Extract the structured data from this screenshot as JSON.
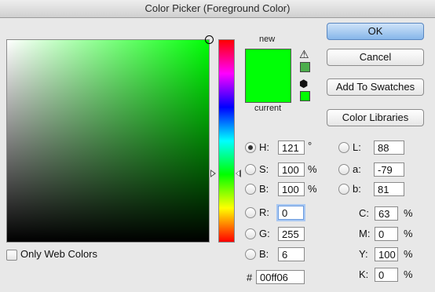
{
  "window": {
    "title": "Color Picker (Foreground Color)"
  },
  "preview": {
    "new_label": "new",
    "current_label": "current",
    "new_color": "#00ff06",
    "current_color": "#00ff06"
  },
  "buttons": {
    "ok": "OK",
    "cancel": "Cancel",
    "add_to_swatches": "Add To Swatches",
    "color_libraries": "Color Libraries"
  },
  "hsb": {
    "h": {
      "label": "H:",
      "value": "121",
      "unit": "°"
    },
    "s": {
      "label": "S:",
      "value": "100",
      "unit": "%"
    },
    "b": {
      "label": "B:",
      "value": "100",
      "unit": "%"
    }
  },
  "rgb": {
    "r": {
      "label": "R:",
      "value": "0"
    },
    "g": {
      "label": "G:",
      "value": "255"
    },
    "b": {
      "label": "B:",
      "value": "6"
    }
  },
  "lab": {
    "l": {
      "label": "L:",
      "value": "88"
    },
    "a": {
      "label": "a:",
      "value": "-79"
    },
    "b": {
      "label": "b:",
      "value": "81"
    }
  },
  "cmyk": {
    "c": {
      "label": "C:",
      "value": "63",
      "unit": "%"
    },
    "m": {
      "label": "M:",
      "value": "0",
      "unit": "%"
    },
    "y": {
      "label": "Y:",
      "value": "100",
      "unit": "%"
    },
    "k": {
      "label": "K:",
      "value": "0",
      "unit": "%"
    }
  },
  "hex": {
    "label": "#",
    "value": "00ff06"
  },
  "web_colors": {
    "label": "Only Web Colors",
    "checked": false
  },
  "icons": {
    "gamut_warning": "warning-triangle-icon",
    "web_safe": "cube-icon"
  },
  "warning_colors": {
    "gamut_swatch": "#4cae4c",
    "websafe_swatch": "#00ff00"
  }
}
